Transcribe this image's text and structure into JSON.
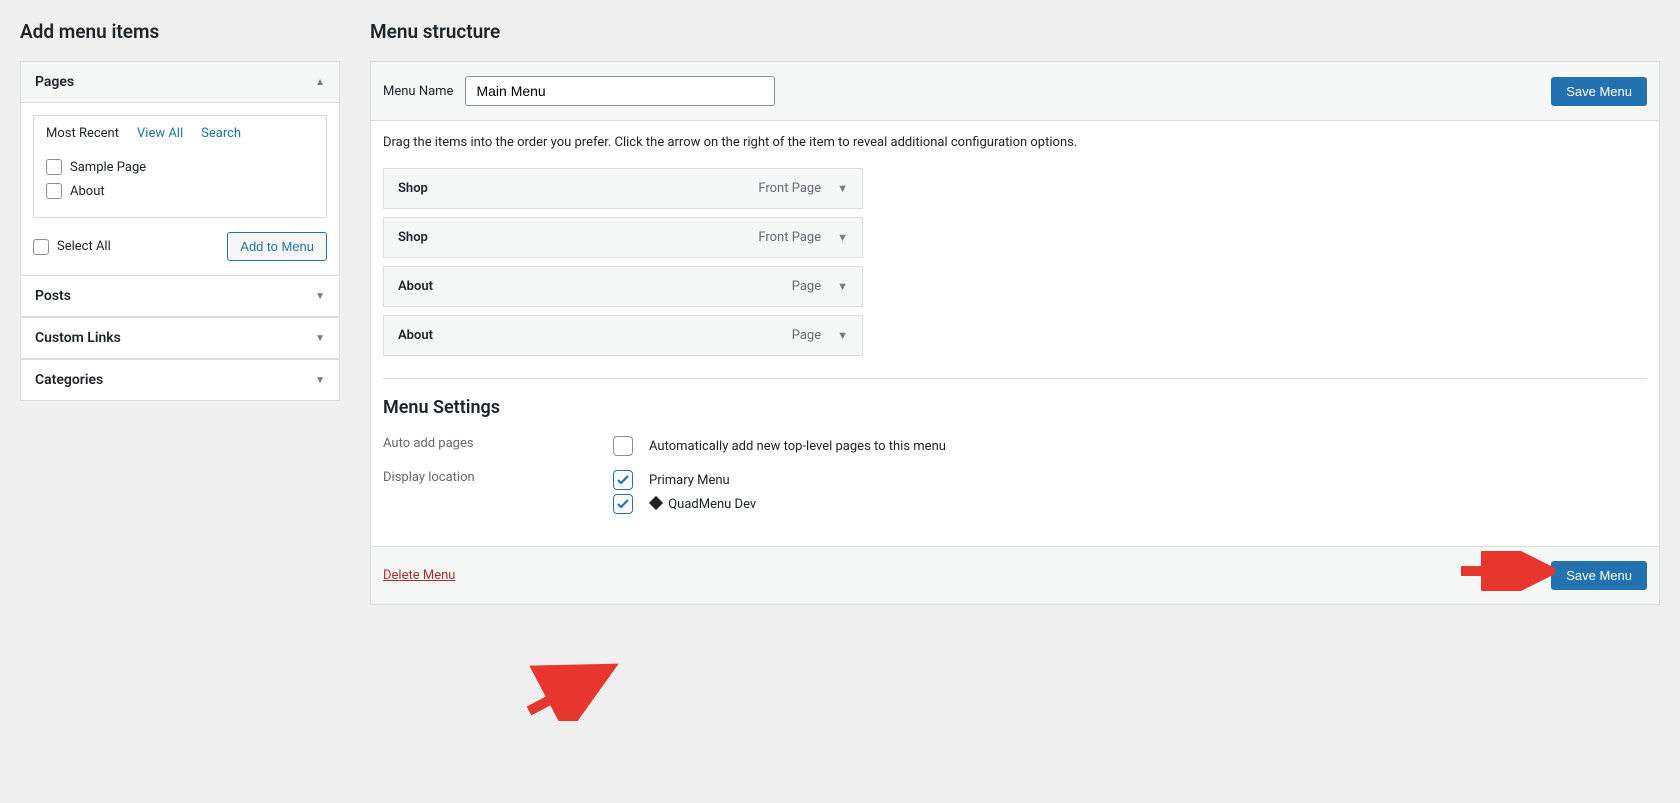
{
  "left": {
    "title": "Add menu items",
    "pages_label": "Pages",
    "tabs": {
      "recent": "Most Recent",
      "view_all": "View All",
      "search": "Search"
    },
    "items": [
      {
        "label": "Sample Page"
      },
      {
        "label": "About"
      }
    ],
    "select_all": "Select All",
    "add_to_menu": "Add to Menu",
    "sections": [
      {
        "label": "Posts"
      },
      {
        "label": "Custom Links"
      },
      {
        "label": "Categories"
      }
    ]
  },
  "right": {
    "title": "Menu structure",
    "menu_name_label": "Menu Name",
    "menu_name_value": "Main Menu",
    "save_button": "Save Menu",
    "hint": "Drag the items into the order you prefer. Click the arrow on the right of the item to reveal additional configuration options.",
    "menu_items": [
      {
        "title": "Shop",
        "type": "Front Page"
      },
      {
        "title": "Shop",
        "type": "Front Page"
      },
      {
        "title": "About",
        "type": "Page"
      },
      {
        "title": "About",
        "type": "Page"
      }
    ],
    "settings_title": "Menu Settings",
    "auto_add_label": "Auto add pages",
    "auto_add_text": "Automatically add new top-level pages to this menu",
    "display_loc_label": "Display location",
    "locations": [
      {
        "label": "Primary Menu",
        "checked": true,
        "icon": false
      },
      {
        "label": "QuadMenu Dev",
        "checked": true,
        "icon": true
      }
    ],
    "delete_label": "Delete Menu"
  }
}
